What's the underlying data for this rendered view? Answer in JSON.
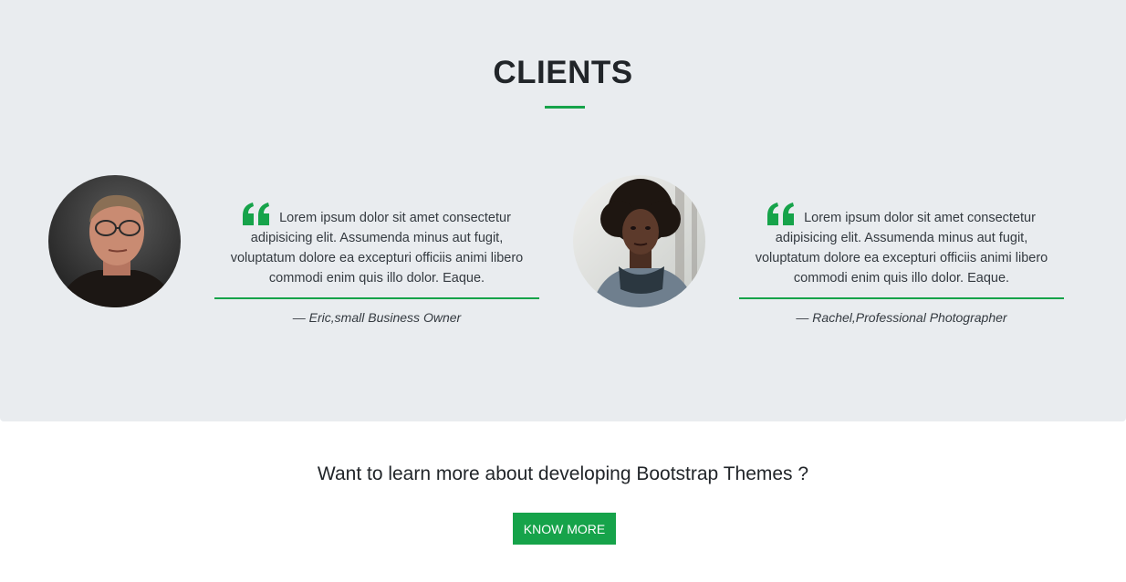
{
  "clients": {
    "title": "CLIENTS",
    "testimonials": [
      {
        "quote": "Lorem ipsum dolor sit amet consectetur adipisicing elit. Assumenda minus aut fugit, voluptatum dolore ea excepturi officiis animi libero commodi enim quis illo dolor. Eaque.",
        "author": "— Eric,small Business Owner",
        "avatar_icon": "client-photo-eric"
      },
      {
        "quote": "Lorem ipsum dolor sit amet consectetur adipisicing elit. Assumenda minus aut fugit, voluptatum dolore ea excepturi officiis animi libero commodi enim quis illo dolor. Eaque.",
        "author": "— Rachel,Professional Photographer",
        "avatar_icon": "client-photo-rachel"
      }
    ]
  },
  "cta": {
    "heading": "Want to learn more about developing Bootstrap Themes ?",
    "button_label": "KNOW MORE"
  },
  "colors": {
    "accent": "#16a34a",
    "section_bg": "#e9ecef",
    "text": "#212529"
  }
}
